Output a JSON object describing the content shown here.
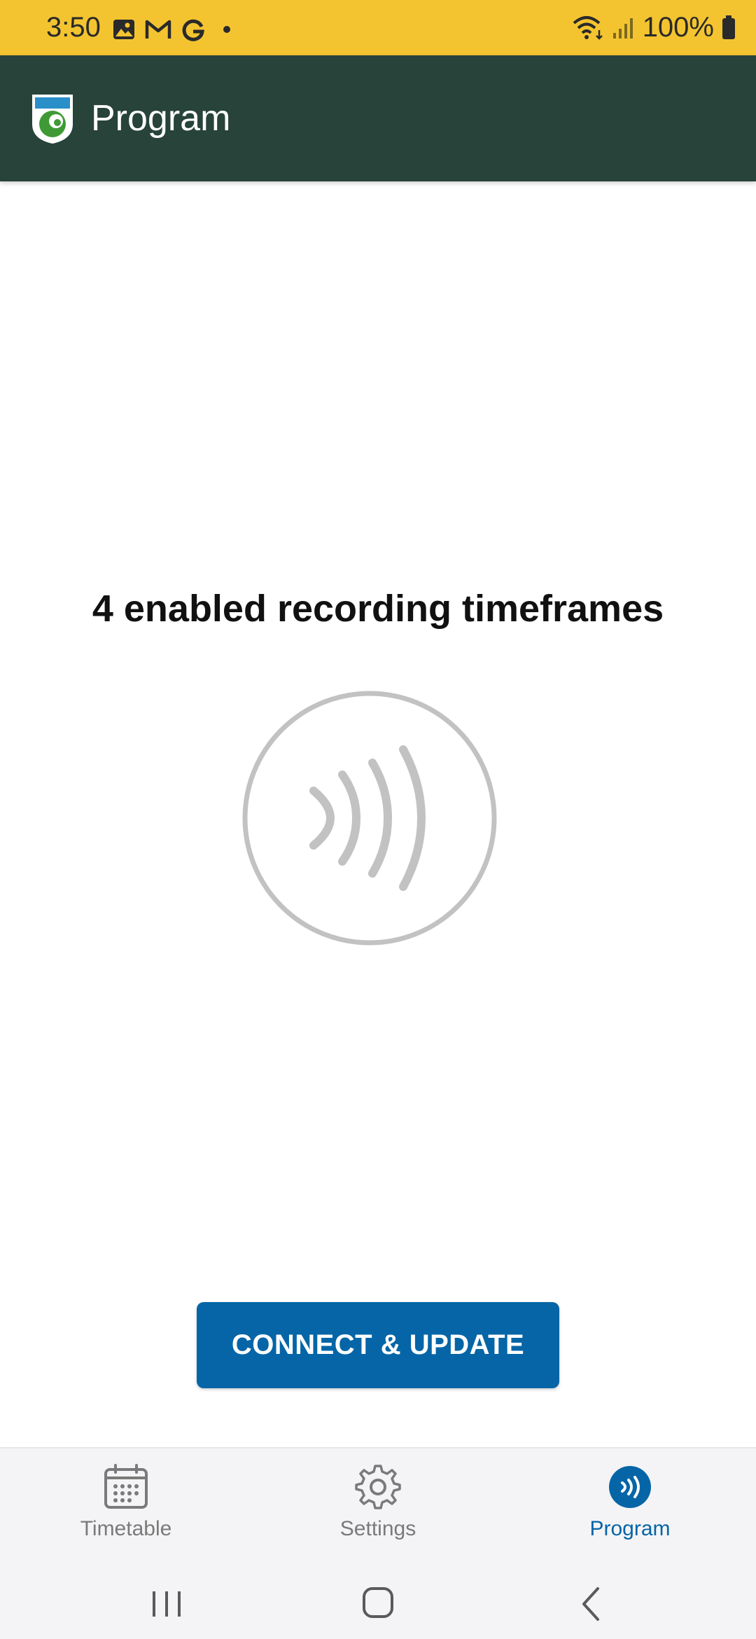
{
  "status_bar": {
    "time": "3:50",
    "battery": "100%",
    "left_icons": [
      "image-icon",
      "gmail-icon",
      "google-icon",
      "dot-icon"
    ],
    "right_icons": [
      "wifi-icon",
      "signal-icon",
      "battery-icon"
    ]
  },
  "app_bar": {
    "title": "Program",
    "logo": "shield-logo"
  },
  "main": {
    "headline": "4 enabled recording timeframes",
    "graphic": "nfc-icon",
    "connect_button": "CONNECT & UPDATE"
  },
  "bottom_nav": {
    "items": [
      {
        "label": "Timetable",
        "icon": "calendar-icon",
        "active": false
      },
      {
        "label": "Settings",
        "icon": "gear-icon",
        "active": false
      },
      {
        "label": "Program",
        "icon": "nfc-icon",
        "active": true
      }
    ]
  },
  "system_nav": {
    "buttons": [
      "recents-button",
      "home-button",
      "back-button"
    ]
  },
  "colors": {
    "status_bar": "#f4c430",
    "app_bar": "#27433a",
    "primary": "#0565a7",
    "nfc_gray": "#c2c2c2",
    "nav_inactive": "#7a7a7a"
  }
}
